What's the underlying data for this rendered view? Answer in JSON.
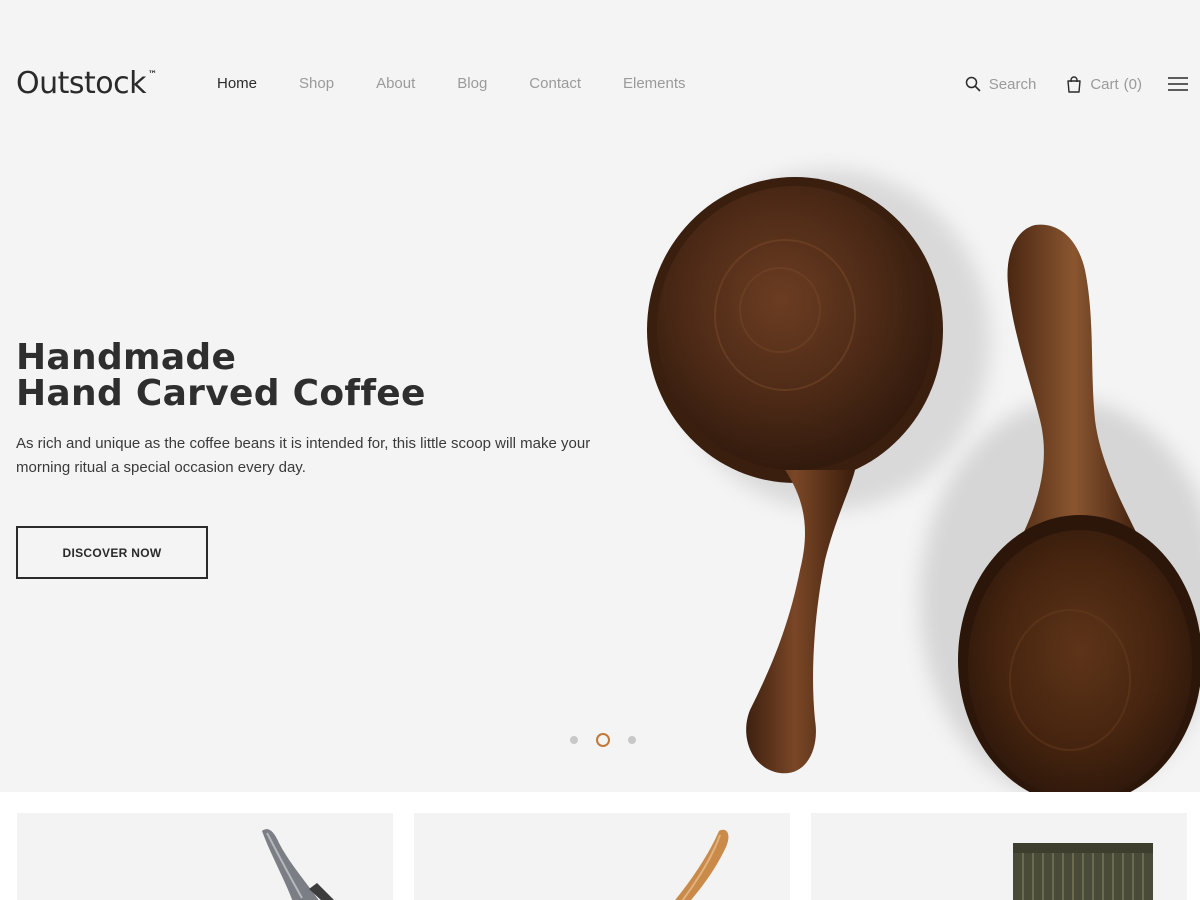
{
  "brand": {
    "name": "Outstock",
    "trademark": "™"
  },
  "nav": {
    "items": [
      {
        "label": "Home",
        "active": true
      },
      {
        "label": "Shop",
        "active": false
      },
      {
        "label": "About",
        "active": false
      },
      {
        "label": "Blog",
        "active": false
      },
      {
        "label": "Contact",
        "active": false
      },
      {
        "label": "Elements",
        "active": false
      }
    ]
  },
  "header_actions": {
    "search_label": "Search",
    "cart_label": "Cart",
    "cart_count": "(0)",
    "icons": [
      "search-icon",
      "shopping-bag-icon",
      "hamburger-menu-icon"
    ]
  },
  "hero": {
    "title_line1": "Handmade",
    "title_line2": "Hand Carved Coffee",
    "description": "As rich and unique as the coffee beans it is intended for, this little scoop will make your morning ritual a special occasion every day.",
    "cta_label": "DISCOVER NOW",
    "slides_count": 3,
    "active_slide": 2
  },
  "colors": {
    "background": "#f4f4f4",
    "text_dark": "#2a2a2a",
    "nav_muted": "#9a9a9a",
    "accent": "#c27a3a",
    "wood": "#5a3420"
  },
  "products": {
    "cards": [
      {
        "subject": "knife"
      },
      {
        "subject": "wooden-utensil"
      },
      {
        "subject": "textile"
      }
    ]
  }
}
